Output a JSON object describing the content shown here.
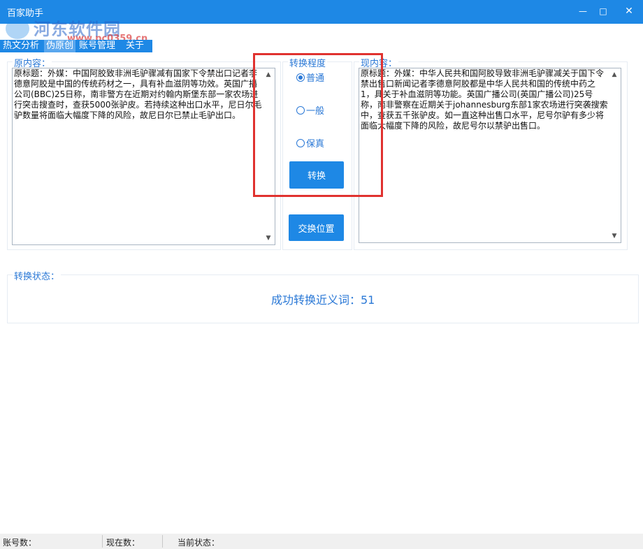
{
  "window": {
    "title": "百家助手",
    "minimize_label": "—",
    "maximize_label": "□",
    "close_label": "✕"
  },
  "watermark": {
    "text": "河东软件园",
    "url": "www.pc0359.cn"
  },
  "menu": {
    "items": [
      {
        "label": "热文分析"
      },
      {
        "label": "伪原创"
      },
      {
        "label": "账号管理"
      },
      {
        "label": "关于"
      }
    ]
  },
  "original_panel": {
    "label": "原内容：",
    "text": "原标题：外媒：中国阿胶致非洲毛驴骤减有国家下令禁出口记者李德意阿胶是中国的传统药材之一，具有补血滋阴等功效。英国广播公司(BBC)25日称，南非警方在近期对约翰内斯堡东部一家农场进行突击搜查时，查获5000张驴皮。若持续这种出口水平，尼日尔毛驴数量将面临大幅度下降的风险，故尼日尔已禁止毛驴出口。"
  },
  "degree": {
    "label": "转换程度",
    "options": [
      {
        "label": "普通",
        "checked": true
      },
      {
        "label": "一般",
        "checked": false
      },
      {
        "label": "保真",
        "checked": false
      }
    ],
    "convert_button": "转换",
    "swap_button": "交换位置"
  },
  "current_panel": {
    "label": "现内容：",
    "text": "原标题：外媒：中华人民共和国阿胶导致非洲毛驴骤减关于国下令禁出售口新闻记者李德意阿胶都是中华人民共和国的传统中药之1，具关于补血滋阴等功能。英国广播公司(英国广播公司)25号称，南非警察在近期关于johannesburg东部1家农场进行突袭搜索中，查获五千张驴皮。如一直这种出售口水平，尼号尔驴有多少将面临大幅度下降的风险，故尼号尔以禁驴出售口。"
  },
  "status": {
    "label": "转换状态：",
    "result": "成功转换近义词：51"
  },
  "statusbar": {
    "accounts": "账号数：",
    "articles": "现在数：",
    "current_state": "当前状态："
  },
  "colors": {
    "accent": "#1e88e5",
    "highlight": "#e0322f"
  }
}
